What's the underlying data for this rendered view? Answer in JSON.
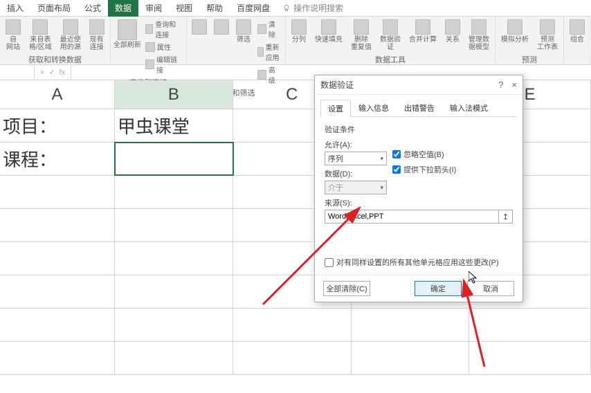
{
  "menu": {
    "tabs": [
      "插入",
      "页面布局",
      "公式",
      "数据",
      "审阅",
      "视图",
      "帮助",
      "百度网盘"
    ],
    "active_index": 3,
    "search_hint": "操作说明搜索"
  },
  "ribbon": {
    "groups": [
      {
        "label": "获取和转换数据",
        "buttons": [
          {
            "label": "自\n网站"
          },
          {
            "label": "来自表\n格/区域"
          },
          {
            "label": "最近使\n用的源"
          },
          {
            "label": "现有\n连接"
          }
        ]
      },
      {
        "label": "查询和连接",
        "big": {
          "label": "全部刷新"
        },
        "minis": [
          "查询和连接",
          "属性",
          "编辑链接"
        ]
      },
      {
        "label": "排序和筛选",
        "buttons": [
          {
            "label": ""
          },
          {
            "label": ""
          },
          {
            "label": "筛选"
          }
        ],
        "minis": [
          "清除",
          "重新应用",
          "高级"
        ]
      },
      {
        "label": "数据工具",
        "buttons": [
          {
            "label": "分列"
          },
          {
            "label": "快速填充"
          },
          {
            "label": "删除\n重复值"
          },
          {
            "label": "数据验\n证"
          },
          {
            "label": "合并计算"
          },
          {
            "label": "关系"
          },
          {
            "label": "管理数\n据模型"
          }
        ]
      },
      {
        "label": "预测",
        "buttons": [
          {
            "label": "模拟分析"
          },
          {
            "label": "预测\n工作表"
          }
        ]
      },
      {
        "label": "",
        "buttons": [
          {
            "label": "组合"
          }
        ]
      }
    ]
  },
  "formula_bar": {
    "name_box": "",
    "fx": "fx"
  },
  "columns": [
    "A",
    "B",
    "C",
    "D",
    "E"
  ],
  "cells": {
    "A1": "项目：",
    "B1": "甲虫课堂",
    "A2": "课程："
  },
  "dialog": {
    "title": "数据验证",
    "help_icon": "?",
    "close_icon": "×",
    "tabs": [
      "设置",
      "输入信息",
      "出错警告",
      "输入法模式"
    ],
    "active_tab": 0,
    "section_title": "验证条件",
    "allow_label": "允许(A):",
    "allow_value": "序列",
    "data_label": "数据(D):",
    "data_value": "介于",
    "source_label": "来源(S):",
    "source_value": "Word,Excel,PPT",
    "ignore_blank_label": "忽略空值(B)",
    "dropdown_label": "提供下拉箭头(I)",
    "apply_label": "对有同样设置的所有其他单元格应用这些更改(P)",
    "clear_btn": "全部清除(C)",
    "ok_btn": "确定",
    "cancel_btn": "取消"
  }
}
